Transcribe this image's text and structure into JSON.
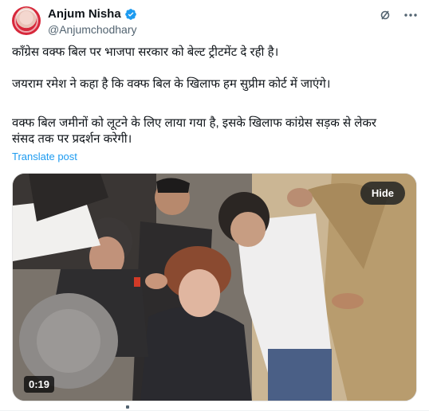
{
  "author": {
    "display_name": "Anjum Nisha",
    "handle": "@Anjumchodhary",
    "verified": true
  },
  "icons": {
    "verified": "verified-badge-icon",
    "grok": "grok-icon",
    "more": "more-options-icon"
  },
  "tweet": {
    "line1": "कॉंग्रेस वक्फ बिल पर भाजपा सरकार को बेल्ट ट्रीटमेंट दे रही है।",
    "line2": "जयराम रमेश ने कहा है कि वक्फ बिल के खिलाफ हम सुप्रीम कोर्ट में जाएंगे।",
    "line3a": "वक्फ बिल जमीनों को लूटने के लिए लाया गया है, इसके खिलाफ कांग्रेस सड़क से लेकर",
    "line3b": "संसद तक पर प्रदर्शन करेगी।"
  },
  "translate_label": "Translate post",
  "media": {
    "hide_label": "Hide",
    "duration": "0:19"
  },
  "colors": {
    "link": "#1d9bf0",
    "verified": "#1d9bf0",
    "secondary_text": "#536471"
  }
}
